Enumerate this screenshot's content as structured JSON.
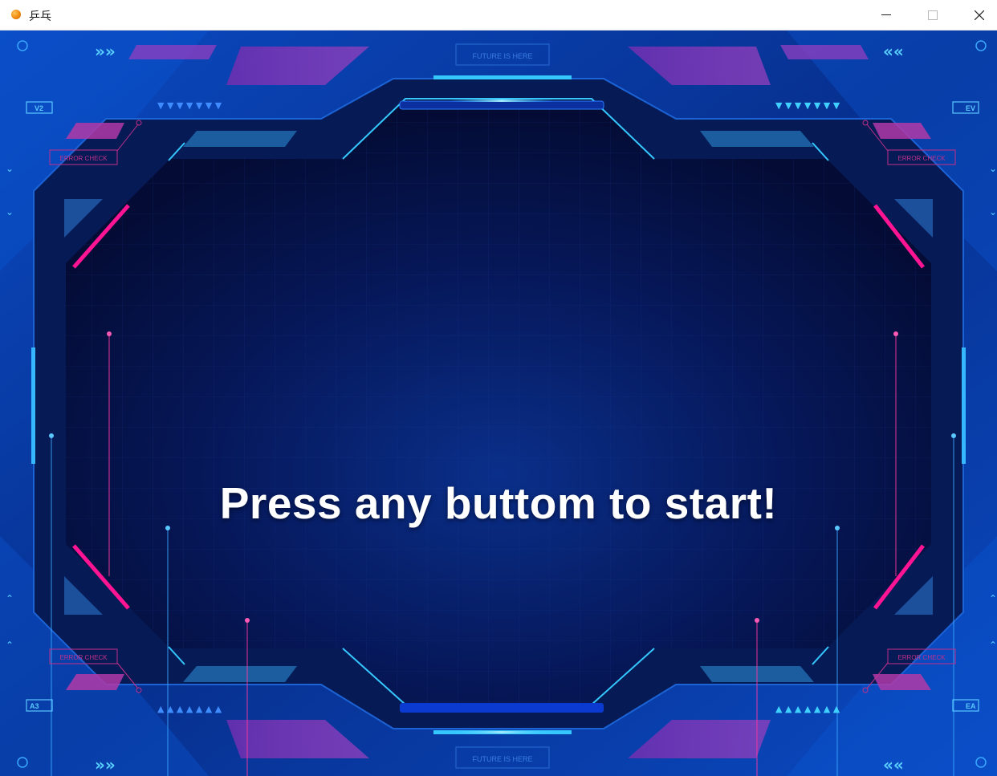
{
  "window": {
    "title": "乒乓",
    "icon": "orange-ball-icon",
    "controls": [
      "minimize-icon",
      "maximize-icon",
      "close-icon"
    ]
  },
  "game": {
    "prompt": "Press any buttom to start!",
    "hud": {
      "future_label": "FUTURE IS HERE",
      "error_label": "ERROR CHECK",
      "tag_top_left": "V2",
      "tag_top_right": "EV",
      "tag_bottom_left": "A3",
      "tag_bottom_right": "EA"
    }
  },
  "colors": {
    "background": "#062067",
    "frame": "#0b3aa8",
    "accent_cyan": "#35c8ff",
    "accent_pink": "#ff1493",
    "accent_purple": "#8a3fbf",
    "text": "#ffffff"
  }
}
